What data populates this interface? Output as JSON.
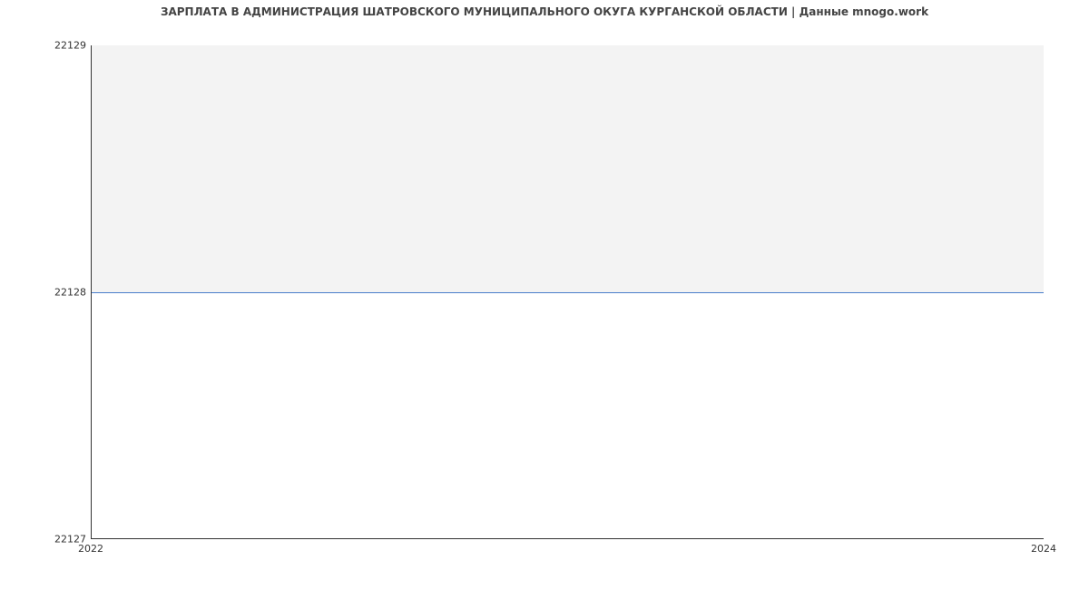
{
  "chart_data": {
    "type": "line",
    "title": "ЗАРПЛАТА В АДМИНИСТРАЦИЯ ШАТРОВСКОГО МУНИЦИПАЛЬНОГО ОКУГА КУРГАНСКОЙ ОБЛАСТИ | Данные mnogo.work",
    "x": [
      2022,
      2024
    ],
    "values": [
      22128,
      22128
    ],
    "y_ticks": [
      22127,
      22128,
      22129
    ],
    "x_ticks": [
      2022,
      2024
    ],
    "ylim": [
      22127,
      22129
    ],
    "xlabel": "",
    "ylabel": ""
  },
  "labels": {
    "ytick_top": "22129",
    "ytick_mid": "22128",
    "ytick_bot": "22127",
    "xtick_left": "2022",
    "xtick_right": "2024"
  }
}
